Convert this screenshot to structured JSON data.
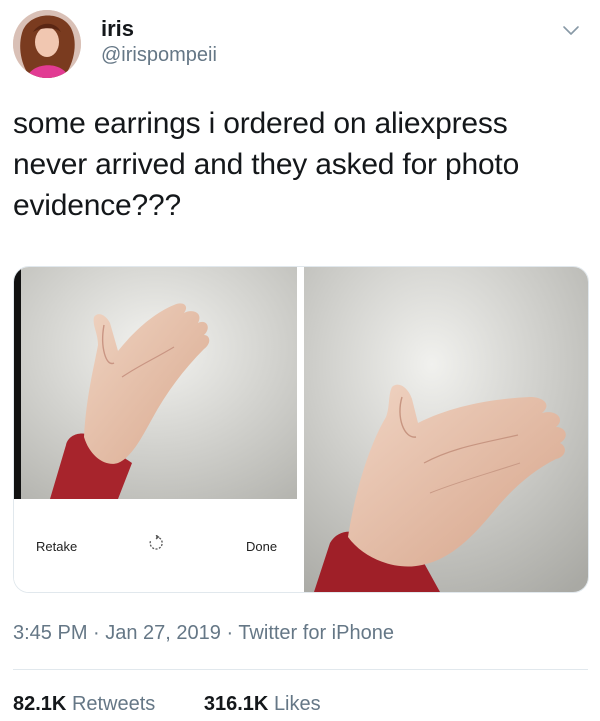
{
  "author": {
    "name": "iris",
    "handle": "@irispompeii"
  },
  "tweet": {
    "text": "some earrings i ordered on aliexpress never arrived and they asked for photo evidence???"
  },
  "media": {
    "left_photo": {
      "retake_label": "Retake",
      "done_label": "Done"
    }
  },
  "meta": {
    "timestamp": "3:45 PM · Jan 27, 2019 · Twitter for iPhone"
  },
  "stats": {
    "retweets_count": "82.1K",
    "retweets_label": "Retweets",
    "likes_count": "316.1K",
    "likes_label": "Likes"
  },
  "icons": {
    "menu": "chevron-down-icon",
    "rotate": "rotate-icon"
  }
}
